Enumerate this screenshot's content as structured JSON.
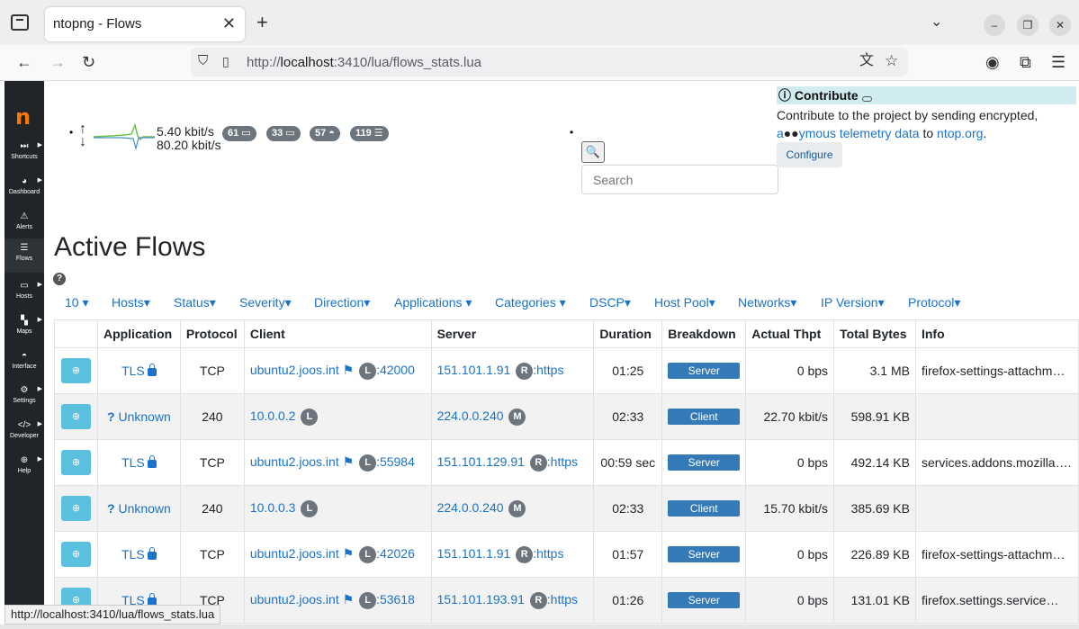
{
  "browser": {
    "tab_title": "ntopng - Flows",
    "url_prefix": "http://",
    "url_host": "localhost",
    "url_path": ":3410/lua/flows_stats.lua",
    "status_url": "http://localhost:3410/lua/flows_stats.lua"
  },
  "sidebar": {
    "logo": "n",
    "items": [
      {
        "label": "Shortcuts",
        "icon": "⏭"
      },
      {
        "label": "Dashboard",
        "icon": "◕"
      },
      {
        "label": "Alerts",
        "icon": "⚠"
      },
      {
        "label": "Flows",
        "icon": "☰"
      },
      {
        "label": "Hosts",
        "icon": "▭"
      },
      {
        "label": "Maps",
        "icon": "▚"
      },
      {
        "label": "Interface",
        "icon": "◓"
      },
      {
        "label": "Settings",
        "icon": "⚙"
      },
      {
        "label": "Developer",
        "icon": "</>"
      },
      {
        "label": "Help",
        "icon": "⊕"
      }
    ]
  },
  "topstats": {
    "upload": "5.40 kbit/s",
    "download": "80.20 kbit/s",
    "badges": [
      "61",
      "33",
      "57",
      "119"
    ]
  },
  "search": {
    "placeholder": "Search"
  },
  "contribute": {
    "title": "Contribute",
    "text_before": "Contribute to the project by sending encrypted,",
    "link1_pre": "a",
    "link1_post": "ymous telemetry data",
    "text_mid": "to",
    "link2": "ntop.org",
    "text_end": ".",
    "button": "Configure"
  },
  "page": {
    "title": "Active Flows"
  },
  "filters": [
    "10",
    "Hosts",
    "Status",
    "Severity",
    "Direction",
    "Applications",
    "Categories",
    "DSCP",
    "Host Pool",
    "Networks",
    "IP Version",
    "Protocol"
  ],
  "table": {
    "headers": [
      "",
      "Application",
      "Protocol",
      "Client",
      "Server",
      "Duration",
      "Breakdown",
      "Actual Thpt",
      "Total Bytes",
      "Info"
    ],
    "rows": [
      {
        "app": "TLS",
        "secure": true,
        "proto": "TCP",
        "client": "ubuntu2.joos.int",
        "client_flag": true,
        "client_badge": "L",
        "client_port": ":42000",
        "server": "151.101.1.91",
        "server_badge": "R",
        "server_port": ":https",
        "duration": "01:25",
        "breakdown": "Server",
        "thpt": "0 bps",
        "bytes": "3.1 MB",
        "info": "firefox-settings-attachm…"
      },
      {
        "app": "Unknown",
        "secure": false,
        "proto": "240",
        "client": "10.0.0.2",
        "client_flag": false,
        "client_badge": "L",
        "client_port": "",
        "server": "224.0.0.240",
        "server_badge": "M",
        "server_port": "",
        "duration": "02:33",
        "breakdown": "Client",
        "thpt": "22.70 kbit/s",
        "bytes": "598.91 KB",
        "info": ""
      },
      {
        "app": "TLS",
        "secure": true,
        "proto": "TCP",
        "client": "ubuntu2.joos.int",
        "client_flag": true,
        "client_badge": "L",
        "client_port": ":55984",
        "server": "151.101.129.91",
        "server_badge": "R",
        "server_port": ":https",
        "duration": "00:59 sec",
        "breakdown": "Server",
        "thpt": "0 bps",
        "bytes": "492.14 KB",
        "info": "services.addons.mozilla…."
      },
      {
        "app": "Unknown",
        "secure": false,
        "proto": "240",
        "client": "10.0.0.3",
        "client_flag": false,
        "client_badge": "L",
        "client_port": "",
        "server": "224.0.0.240",
        "server_badge": "M",
        "server_port": "",
        "duration": "02:33",
        "breakdown": "Client",
        "thpt": "15.70 kbit/s",
        "bytes": "385.69 KB",
        "info": ""
      },
      {
        "app": "TLS",
        "secure": true,
        "proto": "TCP",
        "client": "ubuntu2.joos.int",
        "client_flag": true,
        "client_badge": "L",
        "client_port": ":42026",
        "server": "151.101.1.91",
        "server_badge": "R",
        "server_port": ":https",
        "duration": "01:57",
        "breakdown": "Server",
        "thpt": "0 bps",
        "bytes": "226.89 KB",
        "info": "firefox-settings-attachm…"
      },
      {
        "app": "TLS",
        "secure": true,
        "proto": "TCP",
        "client": "ubuntu2.joos.int",
        "client_flag": true,
        "client_badge": "L",
        "client_port": ":53618",
        "server": "151.101.193.91",
        "server_badge": "R",
        "server_port": ":https",
        "duration": "01:26",
        "breakdown": "Server",
        "thpt": "0 bps",
        "bytes": "131.01 KB",
        "info": "firefox.settings.service…"
      }
    ]
  },
  "colors": {
    "link": "#1a73c8",
    "sidebar": "#212529",
    "logo": "#ff7500",
    "badge": "#6c757d",
    "zoom": "#5bc0de",
    "bar": "#337ab7"
  }
}
